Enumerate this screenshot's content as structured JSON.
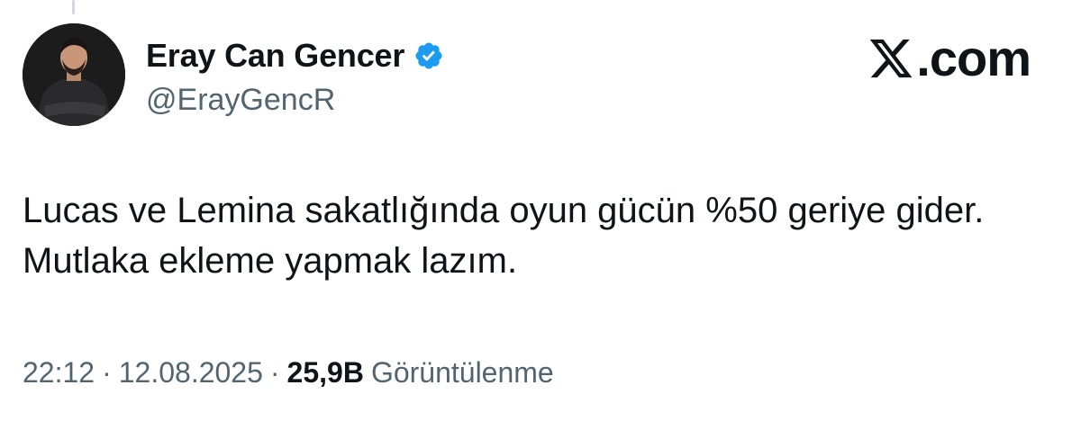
{
  "author": {
    "display_name": "Eray Can Gencer",
    "handle": "@ErayGencR",
    "verified": true,
    "verified_color": "#1d9bf0"
  },
  "brand": {
    "icon": "x-logo-icon",
    "text": ".com"
  },
  "tweet": {
    "text": "Lucas ve Lemina sakatlığında oyun gücün %50 geriye gider. Mutlaka ekleme yapmak lazım."
  },
  "meta": {
    "time": "22:12",
    "separator": "·",
    "date": "12.08.2025",
    "views_count": "25,9B",
    "views_label": "Görüntülenme"
  },
  "colors": {
    "text_primary": "#0f1419",
    "text_secondary": "#536471",
    "background": "#ffffff"
  }
}
